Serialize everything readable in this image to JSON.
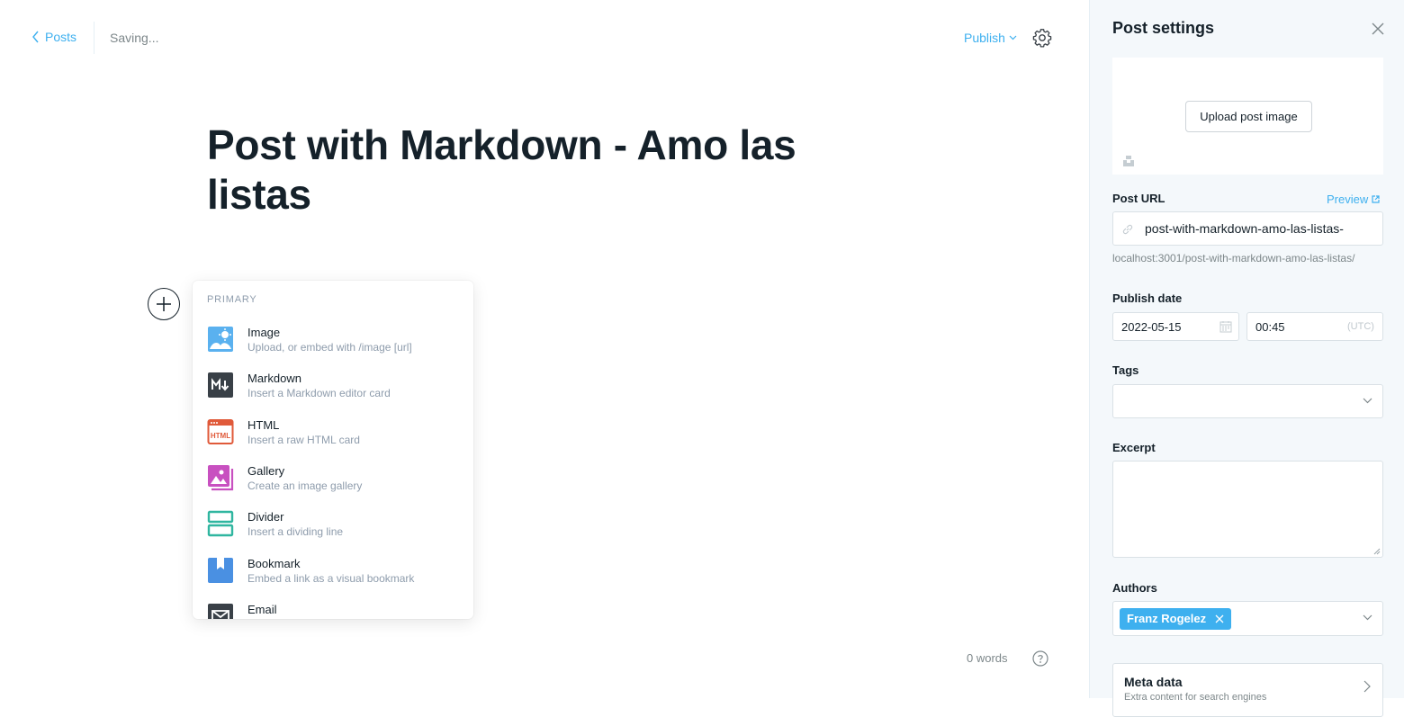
{
  "header": {
    "back_label": "Posts",
    "status": "Saving...",
    "publish_label": "Publish"
  },
  "post": {
    "title": "Post with Markdown - Amo las listas"
  },
  "card_menu": {
    "section": "PRIMARY",
    "items": [
      {
        "label": "Image",
        "description": "Upload, or embed with /image [url]",
        "icon": "image-card-icon",
        "color": "#3eb0ef"
      },
      {
        "label": "Markdown",
        "description": "Insert a Markdown editor card",
        "icon": "markdown-card-icon",
        "color": "#394047"
      },
      {
        "label": "HTML",
        "description": "Insert a raw HTML card",
        "icon": "html-card-icon",
        "color": "#e05a3a"
      },
      {
        "label": "Gallery",
        "description": "Create an image gallery",
        "icon": "gallery-card-icon",
        "color": "#c850c0"
      },
      {
        "label": "Divider",
        "description": "Insert a dividing line",
        "icon": "divider-card-icon",
        "color": "#30b6a0"
      },
      {
        "label": "Bookmark",
        "description": "Embed a link as a visual bookmark",
        "icon": "bookmark-card-icon",
        "color": "#4a90e2"
      },
      {
        "label": "Email",
        "description": "",
        "icon": "email-card-icon",
        "color": "#394047"
      }
    ]
  },
  "footer": {
    "word_count": "0 words"
  },
  "settings": {
    "title": "Post settings",
    "upload_label": "Upload post image",
    "url_label": "Post URL",
    "preview_label": "Preview",
    "slug": "post-with-markdown-amo-las-listas-",
    "url_hint": "localhost:3001/post-with-markdown-amo-las-listas/",
    "publish_date_label": "Publish date",
    "date": "2022-05-15",
    "time": "00:45",
    "timezone": "(UTC)",
    "tags_label": "Tags",
    "excerpt_label": "Excerpt",
    "authors_label": "Authors",
    "author": "Franz Rogelez",
    "meta_title": "Meta data",
    "meta_subtitle": "Extra content for search engines"
  },
  "colors": {
    "accent": "#3eb0ef",
    "text": "#15212a",
    "muted": "#7d878a",
    "panel_bg": "#f4f8fb"
  }
}
